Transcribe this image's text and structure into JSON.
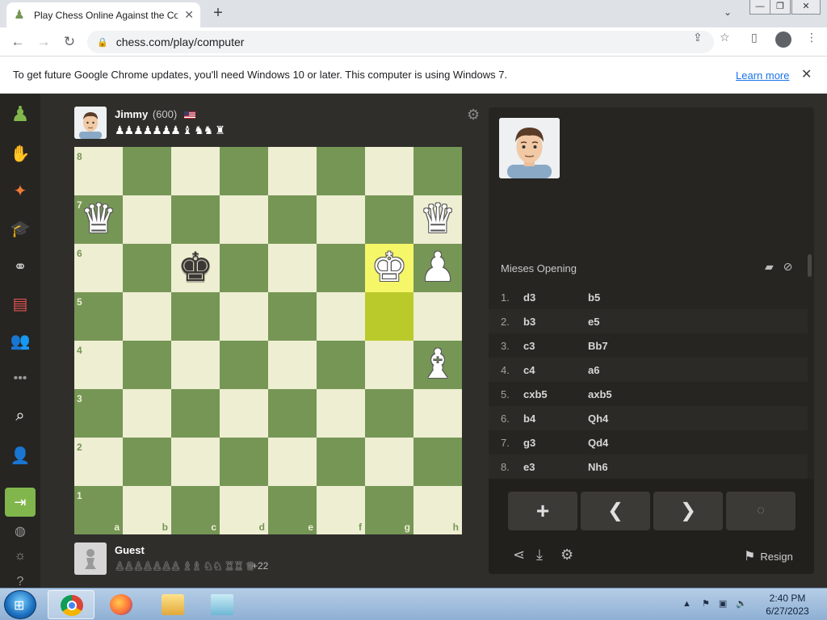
{
  "browser": {
    "tab_title": "Play Chess Online Against the Co",
    "url": "chess.com/play/computer",
    "info_message": "To get future Google Chrome updates, you'll need Windows 10 or later. This computer is using Windows 7.",
    "learn_more": "Learn more"
  },
  "top_player": {
    "name": "Jimmy",
    "rating": "(600)",
    "captured": "♟♟♟♟♟♟♟ ♝ ♞♞ ♜"
  },
  "bottom_player": {
    "name": "Guest",
    "captured": "♙♙♙♙♙♙♙ ♗♗ ♘♘ ♖♖ ♕",
    "advantage": "+22"
  },
  "board": {
    "files": [
      "a",
      "b",
      "c",
      "d",
      "e",
      "f",
      "g",
      "h"
    ],
    "ranks": [
      "8",
      "7",
      "6",
      "5",
      "4",
      "3",
      "2",
      "1"
    ],
    "highlighted": [
      "g6",
      "g5"
    ],
    "pieces": [
      {
        "square": "a7",
        "glyph": "♛",
        "color": "w"
      },
      {
        "square": "h7",
        "glyph": "♛",
        "color": "w"
      },
      {
        "square": "c6",
        "glyph": "♚",
        "color": "b"
      },
      {
        "square": "g6",
        "glyph": "♚",
        "color": "w"
      },
      {
        "square": "h6",
        "glyph": "♟",
        "color": "w"
      },
      {
        "square": "h4",
        "glyph": "♝",
        "color": "w"
      }
    ]
  },
  "panel": {
    "opening": "Mieses Opening",
    "moves": [
      {
        "num": "1.",
        "white": "d3",
        "black": "b5"
      },
      {
        "num": "2.",
        "white": "b3",
        "black": "e5"
      },
      {
        "num": "3.",
        "white": "c3",
        "black": "Bb7"
      },
      {
        "num": "4.",
        "white": "c4",
        "black": "a6"
      },
      {
        "num": "5.",
        "white": "cxb5",
        "black": "axb5"
      },
      {
        "num": "6.",
        "white": "b4",
        "black": "Qh4"
      },
      {
        "num": "7.",
        "white": "g3",
        "black": "Qd4"
      },
      {
        "num": "8.",
        "white": "e3",
        "black": "Nh6"
      }
    ],
    "resign": "Resign"
  },
  "taskbar": {
    "time": "2:40 PM",
    "date": "6/27/2023"
  },
  "colors": {
    "light_square": "#eeeed2",
    "dark_square": "#769656",
    "accent": "#81b64c"
  }
}
